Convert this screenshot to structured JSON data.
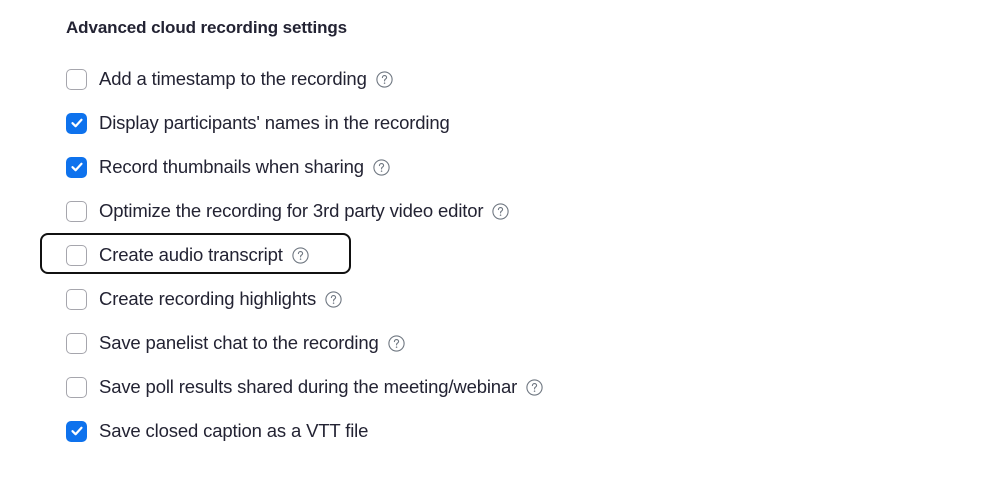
{
  "section": {
    "title": "Advanced cloud recording settings"
  },
  "options": [
    {
      "label": "Add a timestamp to the recording",
      "checked": false,
      "help": true
    },
    {
      "label": "Display participants' names in the recording",
      "checked": true,
      "help": false
    },
    {
      "label": "Record thumbnails when sharing",
      "checked": true,
      "help": true
    },
    {
      "label": "Optimize the recording for 3rd party video editor",
      "checked": false,
      "help": true
    },
    {
      "label": "Create audio transcript",
      "checked": false,
      "help": true,
      "highlighted": true
    },
    {
      "label": "Create recording highlights",
      "checked": false,
      "help": true
    },
    {
      "label": "Save panelist chat to the recording",
      "checked": false,
      "help": true
    },
    {
      "label": "Save poll results shared during the meeting/webinar",
      "checked": false,
      "help": true
    },
    {
      "label": "Save closed caption as a VTT file",
      "checked": true,
      "help": false
    }
  ],
  "colors": {
    "accent": "#0e72ed",
    "text": "#232333",
    "checkbox_border": "#a6a6ad",
    "highlight_border": "#111111"
  },
  "icons": {
    "checkmark": "checkmark-icon",
    "help": "question-circle-icon"
  }
}
